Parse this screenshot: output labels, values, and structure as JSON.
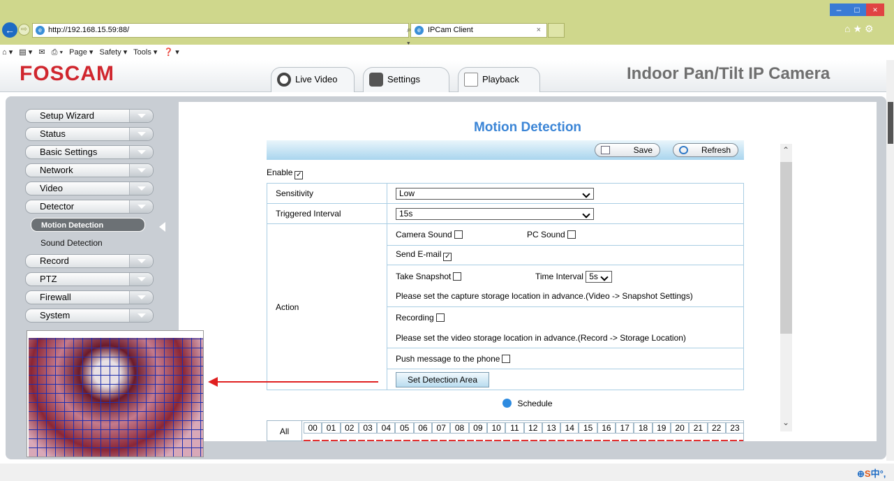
{
  "browser": {
    "url": "http://192.168.15.59:88/",
    "address_tools": "⌕ ▾ ↻",
    "tab_title": "IPCam Client",
    "tab_close": "×",
    "window_min": "–",
    "window_max": "□",
    "window_close": "×",
    "right_icons": "⌂★⚙",
    "back": "←",
    "forward": "⇨",
    "command_bar": [
      "⌂ ▾",
      "▤ ▾",
      "✉",
      "⎙ ▾",
      "Page ▾",
      "Safety ▾",
      "Tools ▾",
      "❓ ▾"
    ]
  },
  "app": {
    "logo": "FOSCAM",
    "product": "Indoor Pan/Tilt IP Camera",
    "tabs": [
      "Live Video",
      "Settings",
      "Playback"
    ]
  },
  "sidebar": {
    "items": [
      "Setup Wizard",
      "Status",
      "Basic Settings",
      "Network",
      "Video",
      "Detector"
    ],
    "sub_items": [
      "Motion Detection",
      "Sound Detection"
    ],
    "items_after": [
      "Record",
      "PTZ",
      "Firewall",
      "System"
    ]
  },
  "main": {
    "title": "Motion Detection",
    "save": "Save",
    "refresh": "Refresh",
    "enable_label": "Enable",
    "enable_checked": "✓",
    "sensitivity_label": "Sensitivity",
    "sensitivity_value": "Low",
    "interval_label": "Triggered Interval",
    "interval_value": "15s",
    "action_label": "Action",
    "camera_sound": "Camera Sound",
    "pc_sound": "PC Sound",
    "send_email": "Send E-mail",
    "send_email_checked": "✓",
    "take_snapshot": "Take Snapshot",
    "time_interval": "Time Interval",
    "time_interval_value": "5s",
    "snapshot_note": "Please set the capture storage location in advance.(Video -> Snapshot Settings)",
    "recording": "Recording",
    "recording_note": "Please set the video storage location in advance.(Record -> Storage Location)",
    "push": "Push message to the phone",
    "detect_area_btn": "Set Detection Area",
    "schedule": "Schedule",
    "schedule_all": "All",
    "hours": [
      "00",
      "01",
      "02",
      "03",
      "04",
      "05",
      "06",
      "07",
      "08",
      "09",
      "10",
      "11",
      "12",
      "13",
      "14",
      "15",
      "16",
      "17",
      "18",
      "19",
      "20",
      "21",
      "22",
      "23"
    ]
  },
  "scroll": {
    "up": "⌃",
    "down": "⌄"
  },
  "tray": {
    "zoom": "⊕",
    "s": "S",
    "zh": "中",
    "punct": "°,"
  },
  "colors": {
    "accent": "#3b85d6",
    "brand": "#d0262e",
    "chrome": "#cfd78c",
    "arrow": "#e02020"
  }
}
